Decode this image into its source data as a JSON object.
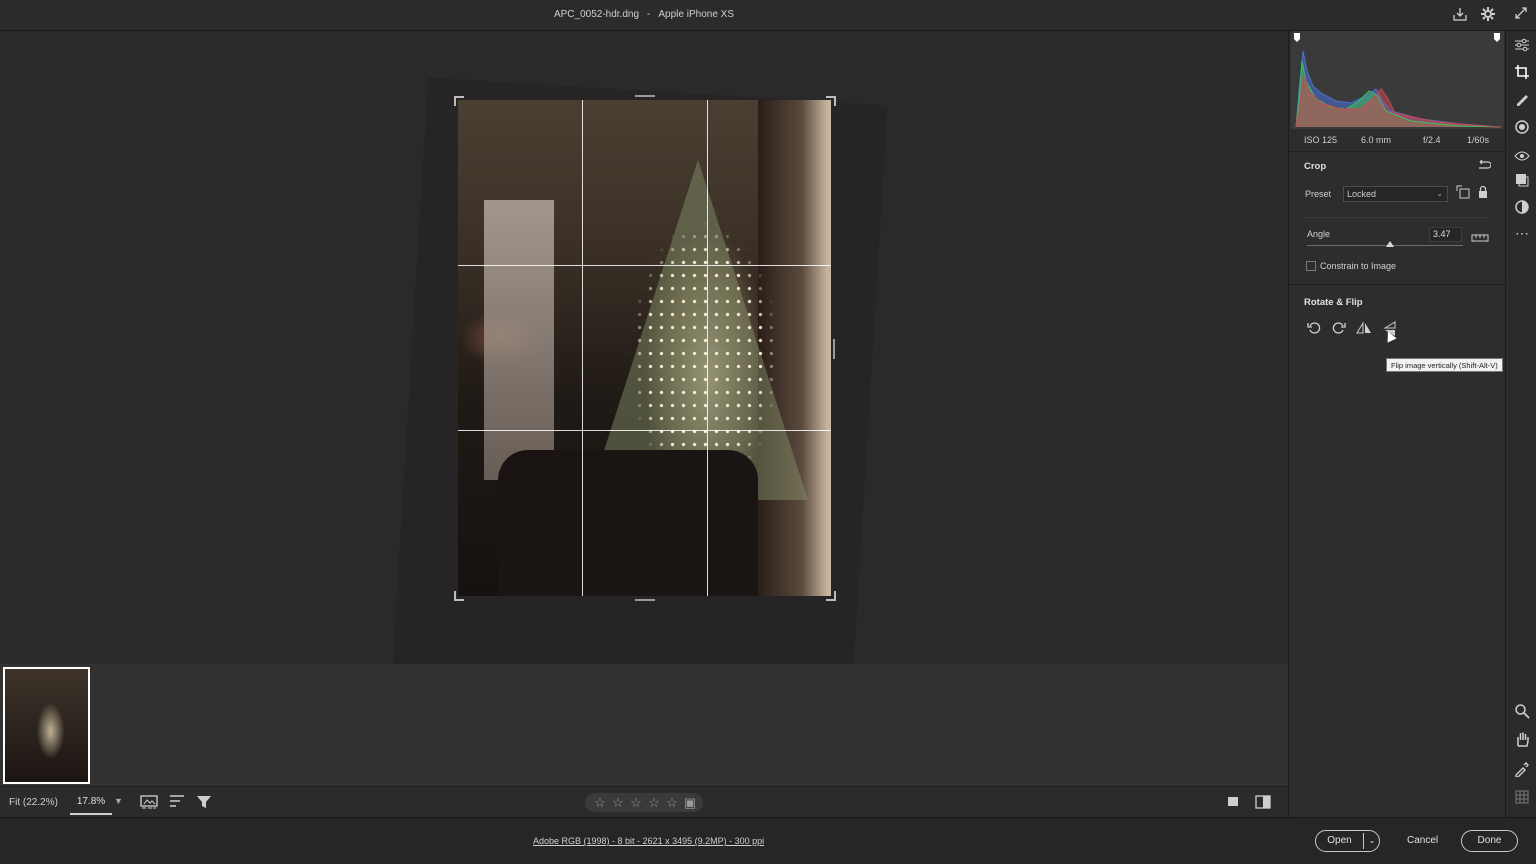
{
  "window": {
    "filename": "APC_0052-hdr.dng",
    "separator": "-",
    "camera": "Apple iPhone XS"
  },
  "titlebar_icons": [
    "save-icon",
    "gear-icon",
    "collapse-icon"
  ],
  "panel": {
    "exif": {
      "iso": "ISO 125",
      "focal": "6.0 mm",
      "aperture": "f/2.4",
      "shutter": "1/60s"
    },
    "crop": {
      "title": "Crop",
      "preset_label": "Preset",
      "preset_value": "Locked",
      "angle_label": "Angle",
      "angle_value": "3.47",
      "angle_slider_fraction": 0.53,
      "constrain_label": "Constrain to Image",
      "constrain_checked": false
    },
    "rotate_flip": {
      "title": "Rotate & Flip",
      "tooltip": "Flip image vertically (Shift-Alt-V)"
    }
  },
  "bottombar": {
    "zoom_fit": "Fit (22.2%)",
    "zoom_value": "17.8%",
    "rating_stars": 5
  },
  "footer": {
    "info": "Adobe RGB (1998) - 8 bit - 2621 x 3495 (9.2MP) - 300 ppi",
    "open_label": "Open",
    "cancel_label": "Cancel",
    "done_label": "Done"
  },
  "colors": {
    "background": "#1e1e1e",
    "panel": "#2d2d2d",
    "canvas": "#2a2a2a",
    "histogram_red": "#d0454c",
    "histogram_green": "#3fbf5a",
    "histogram_blue": "#4a6fd8"
  }
}
